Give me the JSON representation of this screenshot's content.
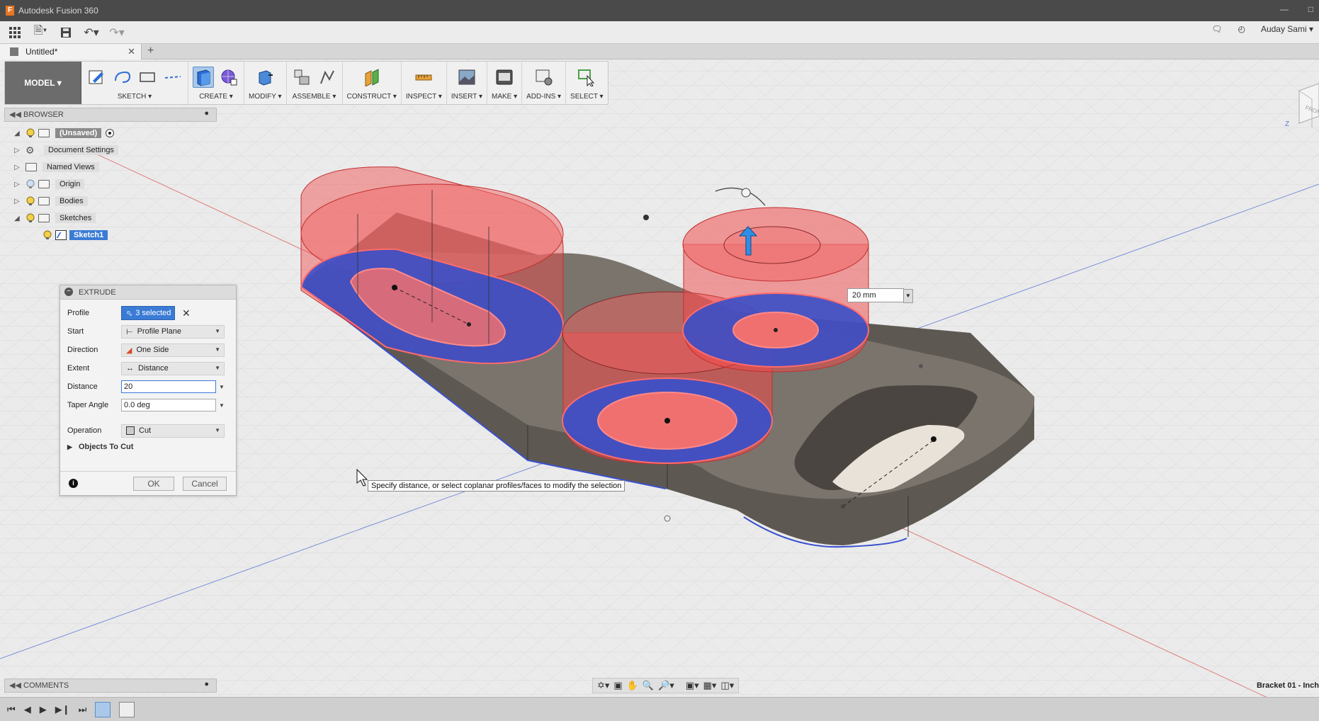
{
  "app": {
    "title": "Autodesk Fusion 360",
    "logo_letter": "F",
    "user": "Auday Sami ▾"
  },
  "tabs": {
    "doc_title": "Untitled*",
    "close": "✕",
    "new": "+"
  },
  "toolbar": {
    "workspace": "MODEL ▾",
    "groups": {
      "sketch": "SKETCH ▾",
      "create": "CREATE ▾",
      "modify": "MODIFY ▾",
      "assemble": "ASSEMBLE ▾",
      "construct": "CONSTRUCT ▾",
      "inspect": "INSPECT ▾",
      "insert": "INSERT ▾",
      "make": "MAKE ▾",
      "addins": "ADD-INS ▾",
      "select": "SELECT ▾"
    }
  },
  "browser": {
    "header": "BROWSER",
    "items": {
      "root": "(Unsaved)",
      "doc_settings": "Document Settings",
      "named_views": "Named Views",
      "origin": "Origin",
      "bodies": "Bodies",
      "sketches": "Sketches",
      "sketch1": "Sketch1"
    }
  },
  "extrude": {
    "title": "EXTRUDE",
    "profile_label": "Profile",
    "profile_value": "3 selected",
    "start_label": "Start",
    "start_value": "Profile Plane",
    "direction_label": "Direction",
    "direction_value": "One Side",
    "extent_label": "Extent",
    "extent_value": "Distance",
    "distance_label": "Distance",
    "distance_value": "20",
    "taper_label": "Taper Angle",
    "taper_value": "0.0 deg",
    "operation_label": "Operation",
    "operation_value": "Cut",
    "objects_to_cut": "Objects To Cut",
    "ok": "OK",
    "cancel": "Cancel"
  },
  "viewport": {
    "tooltip": "Specify distance, or select coplanar profiles/faces to modify the selection",
    "distance_box": "20 mm",
    "viewcube_label": "FRONT",
    "axis_label": "Z"
  },
  "comments": {
    "header": "COMMENTS"
  },
  "status": {
    "doc_name": "Bracket 01 - Inch"
  },
  "colors": {
    "accent": "#3a7bd5",
    "cut_red": "#f04848",
    "profile_blue": "#3a4fc8",
    "body_gray": "#6b655e"
  }
}
